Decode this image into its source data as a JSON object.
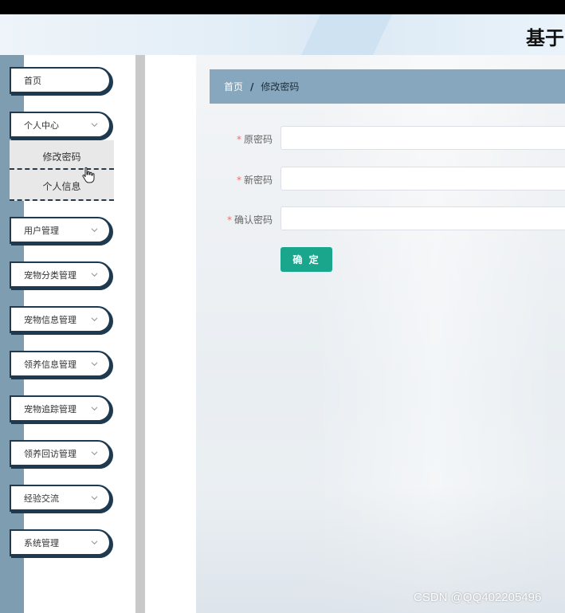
{
  "header": {
    "title": "基于"
  },
  "sidebar": {
    "items": [
      {
        "label": "首页",
        "has_submenu": false
      },
      {
        "label": "个人中心",
        "has_submenu": true,
        "expanded": true
      },
      {
        "label": "用户管理",
        "has_submenu": true
      },
      {
        "label": "宠物分类管理",
        "has_submenu": true
      },
      {
        "label": "宠物信息管理",
        "has_submenu": true
      },
      {
        "label": "领养信息管理",
        "has_submenu": true
      },
      {
        "label": "宠物追踪管理",
        "has_submenu": true
      },
      {
        "label": "领养回访管理",
        "has_submenu": true
      },
      {
        "label": "经验交流",
        "has_submenu": true
      },
      {
        "label": "系统管理",
        "has_submenu": true
      }
    ],
    "submenu": [
      {
        "label": "修改密码"
      },
      {
        "label": "个人信息"
      }
    ]
  },
  "breadcrumb": {
    "home": "首页",
    "separator": "/",
    "current": "修改密码"
  },
  "form": {
    "required_mark": "*",
    "fields": [
      {
        "label": "原密码",
        "value": ""
      },
      {
        "label": "新密码",
        "value": ""
      },
      {
        "label": "确认密码",
        "value": ""
      }
    ],
    "submit_label": "确 定"
  },
  "watermark": "CSDN @QQ402205496",
  "colors": {
    "accent": "#1aa68d",
    "breadcrumb_bg": "#86a7bd",
    "sidebar_strip": "#7f9db1",
    "menu_border": "#1d3a50",
    "required": "#f56c6c"
  }
}
